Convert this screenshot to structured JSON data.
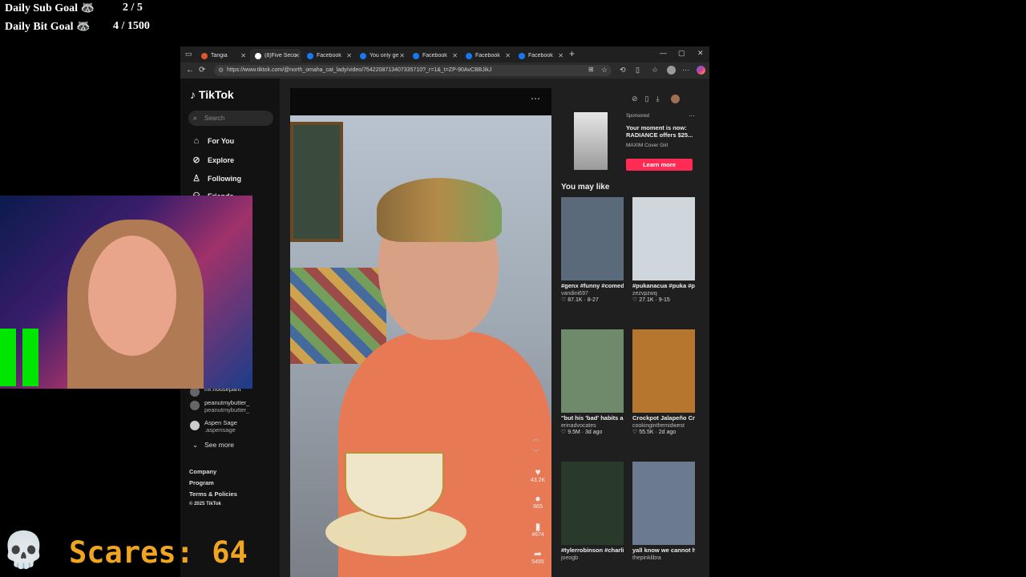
{
  "overlay": {
    "sub_goal_label": "Daily Sub Goal 🦝",
    "sub_goal_value": "2 / 5",
    "bit_goal_label": "Daily Bit Goal 🦝",
    "bit_goal_value": "4 / 1500",
    "scares_label": "Scares:",
    "scares_value": "64",
    "skull_icon": "skull-icon"
  },
  "browser": {
    "tabs": [
      {
        "label": "Tangia",
        "active": false,
        "fav_color": "#e0572a"
      },
      {
        "label": "(8)Five Seco",
        "active": true,
        "fav_color": "#ffffff"
      },
      {
        "label": "Facebook",
        "active": false,
        "fav_color": "#1877f2"
      },
      {
        "label": "You only ge",
        "active": false,
        "fav_color": "#1877f2"
      },
      {
        "label": "Facebook",
        "active": false,
        "fav_color": "#1877f2"
      },
      {
        "label": "Facebook",
        "active": false,
        "fav_color": "#1877f2"
      },
      {
        "label": "Facebook",
        "active": false,
        "fav_color": "#1877f2"
      }
    ],
    "new_tab": "+",
    "url": "https://www.tiktok.com/@north_omaha_cat_lady/video/7542208713407335710?_r=1&_t=ZP-90AvCBBJikJ"
  },
  "tiktok": {
    "logo": "TikTok",
    "search_placeholder": "Search",
    "nav": [
      {
        "label": "For You",
        "icon": "home-icon"
      },
      {
        "label": "Explore",
        "icon": "compass-icon"
      },
      {
        "label": "Following",
        "icon": "user-follow-icon"
      },
      {
        "label": "Friends",
        "icon": "friends-icon"
      }
    ],
    "accounts": [
      {
        "name": "mr.nousepant",
        "handle": ""
      },
      {
        "name": "peanutmybutter_",
        "handle": "peanutmybutter_"
      },
      {
        "name": "Aspen Sage",
        "handle": ".aspensage"
      }
    ],
    "see_more": "See more",
    "footer": [
      "Company",
      "Program",
      "Terms & Policies",
      "© 2025 TikTok"
    ],
    "video": {
      "likes": "43.2K",
      "comments": "865",
      "saves": "4674",
      "shares": "5455"
    },
    "ad": {
      "sponsored": "Sponsored",
      "text": "Your moment is now: RADIANCE offers $25...",
      "brand": "MAXIM Cover Girl",
      "cta": "Learn more"
    },
    "you_may_like": "You may like",
    "cards": [
      {
        "caption": "#genx #funny #comedy...",
        "author": "vandini697",
        "likes": "87.1K",
        "date": "8-27",
        "thumb": "#5a6a7a"
      },
      {
        "caption": "#pukanacua #puka #pukanacuaformvp...",
        "author": "zezvpzwq",
        "likes": "27.1K",
        "date": "9-15",
        "thumb": "#cfd6dc"
      },
      {
        "caption": "\"but his 'bad' habits are going to rub off...",
        "author": "erinadvocates",
        "likes": "9.5M",
        "date": "3d ago",
        "thumb": "#6f8a6a"
      },
      {
        "caption": "Crockpot Jalapeño Crack Chicken...",
        "author": "cookinginthemidwest",
        "likes": "55.5K",
        "date": "2d ago",
        "thumb": "#b7762e"
      },
      {
        "caption": "#tylerrobinson #charliekirk",
        "author": "joeogb",
        "likes": "",
        "date": "",
        "thumb": "#2a3a2a"
      },
      {
        "caption": "yall know we cannot have a movie night...",
        "author": "thepinklibra",
        "likes": "",
        "date": "",
        "thumb": "#6c7a90"
      }
    ]
  }
}
